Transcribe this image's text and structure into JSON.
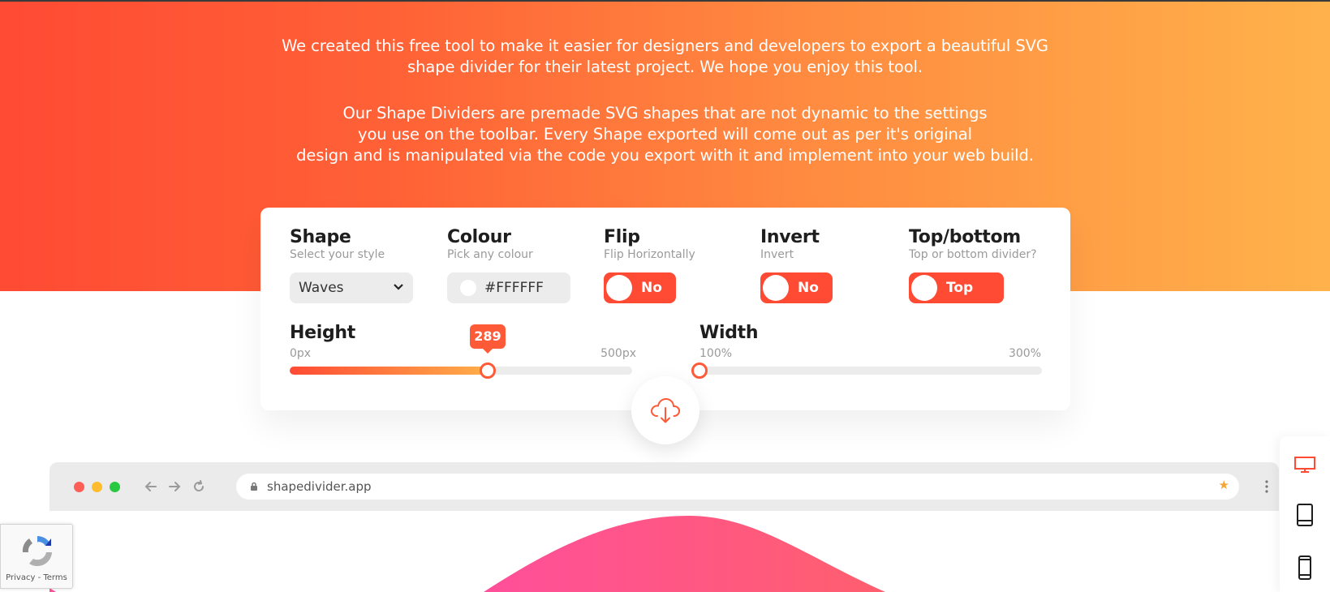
{
  "intro": {
    "paragraph1": [
      "We created this free tool to make it easier for designers and developers to export a beautiful SVG",
      "shape divider for their latest project. We hope you enjoy this tool."
    ],
    "paragraph2": [
      "Our Shape Dividers are premade SVG shapes that are not dynamic to the settings",
      "you use on the toolbar. Every Shape exported will come out as per it's original",
      "design and is manipulated via the code you export with it and implement into your web build."
    ]
  },
  "controls": {
    "shape": {
      "title": "Shape",
      "subtitle": "Select your style",
      "value": "Waves"
    },
    "colour": {
      "title": "Colour",
      "subtitle": "Pick any colour",
      "value": "#FFFFFF"
    },
    "flip": {
      "title": "Flip",
      "subtitle": "Flip Horizontally",
      "value": "No"
    },
    "invert": {
      "title": "Invert",
      "subtitle": "Invert",
      "value": "No"
    },
    "position": {
      "title": "Top/bottom",
      "subtitle": "Top or bottom divider?",
      "value": "Top"
    }
  },
  "sliders": {
    "height": {
      "title": "Height",
      "min_label": "0px",
      "max_label": "500px",
      "min": 0,
      "max": 500,
      "value": 289,
      "value_label": "289"
    },
    "width": {
      "title": "Width",
      "min_label": "100%",
      "max_label": "300%",
      "min": 100,
      "max": 300,
      "value": 100
    }
  },
  "download": {
    "icon": "cloud-download-icon"
  },
  "browser": {
    "url": "shapedivider.app",
    "window_buttons": [
      "#ff5f57",
      "#febc2e",
      "#28c840"
    ]
  },
  "devices": {
    "items": [
      "desktop-icon",
      "tablet-icon",
      "mobile-icon"
    ],
    "active": "desktop-icon"
  },
  "recaptcha": {
    "privacy": "Privacy",
    "separator": " - ",
    "terms": "Terms"
  },
  "colors": {
    "accent": "#ff4b34",
    "gradient_start": "#ff4a34",
    "gradient_end": "#ffb24b",
    "preview_shape": "#ff4f96"
  }
}
